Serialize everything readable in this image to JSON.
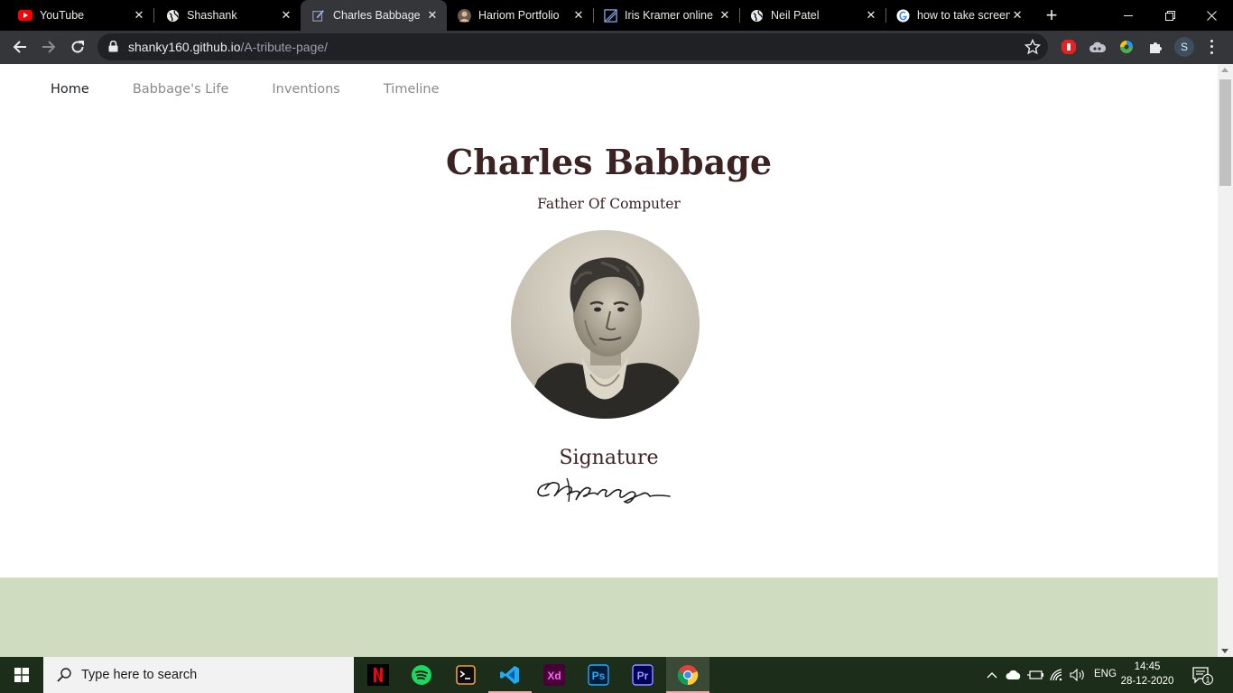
{
  "browser": {
    "tabs": [
      {
        "title": "YouTube",
        "icon": "youtube-icon",
        "active": false
      },
      {
        "title": "Shashank",
        "icon": "globe-icon",
        "active": false
      },
      {
        "title": "Charles Babbage",
        "icon": "pencil-page-icon",
        "active": true
      },
      {
        "title": "Hariom Portfolio",
        "icon": "avatar-icon",
        "active": false
      },
      {
        "title": "Iris Kramer online",
        "icon": "broken-page-icon",
        "active": false
      },
      {
        "title": "Neil Patel",
        "icon": "globe-icon",
        "active": false
      },
      {
        "title": "how to take screen",
        "icon": "google-icon",
        "active": false
      }
    ],
    "address": {
      "host": "shanky160.github.io",
      "path": "/A-tribute-page/"
    },
    "profile_initial": "S"
  },
  "page": {
    "nav": [
      {
        "label": "Home",
        "current": true
      },
      {
        "label": "Babbage's Life",
        "current": false
      },
      {
        "label": "Inventions",
        "current": false
      },
      {
        "label": "Timeline",
        "current": false
      }
    ],
    "title": "Charles Babbage",
    "subtitle": "Father Of Computer",
    "signature_heading": "Signature",
    "signature_text": "C Babbage",
    "colors": {
      "heading": "#3b2323",
      "band": "#d0dcbf"
    }
  },
  "taskbar": {
    "search_placeholder": "Type here to search",
    "apps": [
      "netflix-icon",
      "spotify-icon",
      "terminal-icon",
      "vscode-icon",
      "adobe-xd-icon",
      "photoshop-icon",
      "premiere-icon",
      "chrome-icon"
    ],
    "apps_labels": {
      "xd": "Xd",
      "ps": "Ps",
      "pr": "Pr"
    },
    "language": "ENG",
    "time": "14:45",
    "date": "28-12-2020",
    "notification_count": "1"
  }
}
